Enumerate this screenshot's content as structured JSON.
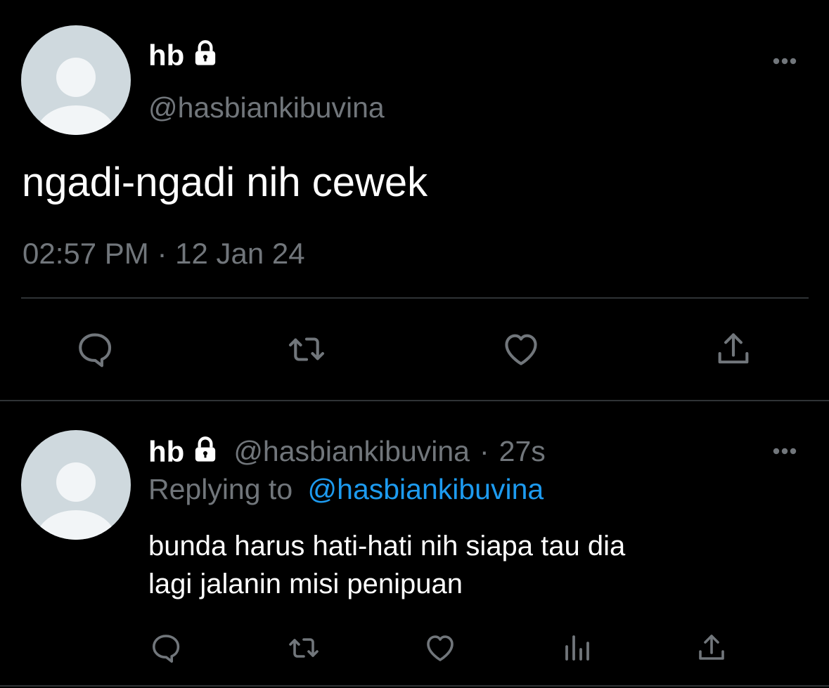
{
  "main_tweet": {
    "display_name": "hb",
    "handle": "@hasbiankibuvina",
    "text": "ngadi-ngadi nih cewek",
    "timestamp": "02:57 PM · 12 Jan 24",
    "more_icon": "more-icon",
    "lock_icon": "lock-icon",
    "actions": [
      "reply-icon",
      "retweet-icon",
      "like-icon",
      "share-icon"
    ]
  },
  "reply_tweet": {
    "display_name": "hb",
    "handle": "@hasbiankibuvina",
    "separator": "·",
    "time_ago": "27s",
    "replying_to_label": "Replying to",
    "replying_to_handle": "@hasbiankibuvina",
    "text_line1": "bunda harus hati-hati nih siapa tau dia",
    "text_line2": "lagi jalanin misi penipuan",
    "actions": [
      "reply-icon",
      "retweet-icon",
      "like-icon",
      "analytics-icon",
      "share-icon"
    ]
  },
  "colors": {
    "background": "#000000",
    "primary_text": "#ffffff",
    "secondary_text": "#71767b",
    "divider": "#2f3336",
    "mention": "#1d9bf0",
    "avatar_bg": "#cfd9de"
  }
}
